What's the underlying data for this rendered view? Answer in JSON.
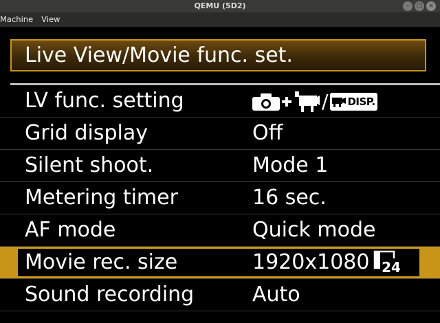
{
  "window": {
    "title": "QEMU (5D2)",
    "buttons": [
      "-",
      "□",
      "×"
    ]
  },
  "menubar": {
    "items": [
      "Machine",
      "View"
    ]
  },
  "menu": {
    "title": "Live View/Movie func. set.",
    "rows": [
      {
        "label": "LV func. setting",
        "value": "",
        "value_icon_text": "DISP."
      },
      {
        "label": "Grid display",
        "value": "Off"
      },
      {
        "label": "Silent shoot.",
        "value": "Mode 1"
      },
      {
        "label": "Metering timer",
        "value": "16 sec."
      },
      {
        "label": "AF mode",
        "value": "Quick mode"
      },
      {
        "label": "Movie rec. size",
        "value": "1920x1080",
        "fps": "24",
        "selected": true
      },
      {
        "label": "Sound recording",
        "value": "Auto"
      }
    ],
    "icons": {
      "lv_setting": [
        "camera-icon",
        "plus-icon",
        "movie-camera-icon",
        "slash",
        "movie-disp-icon"
      ],
      "fps": "frame-rate-icon"
    }
  },
  "colors": {
    "accent": "#c99518",
    "background": "#000000",
    "text": "#ffffff",
    "separator": "#bdbdbd"
  }
}
